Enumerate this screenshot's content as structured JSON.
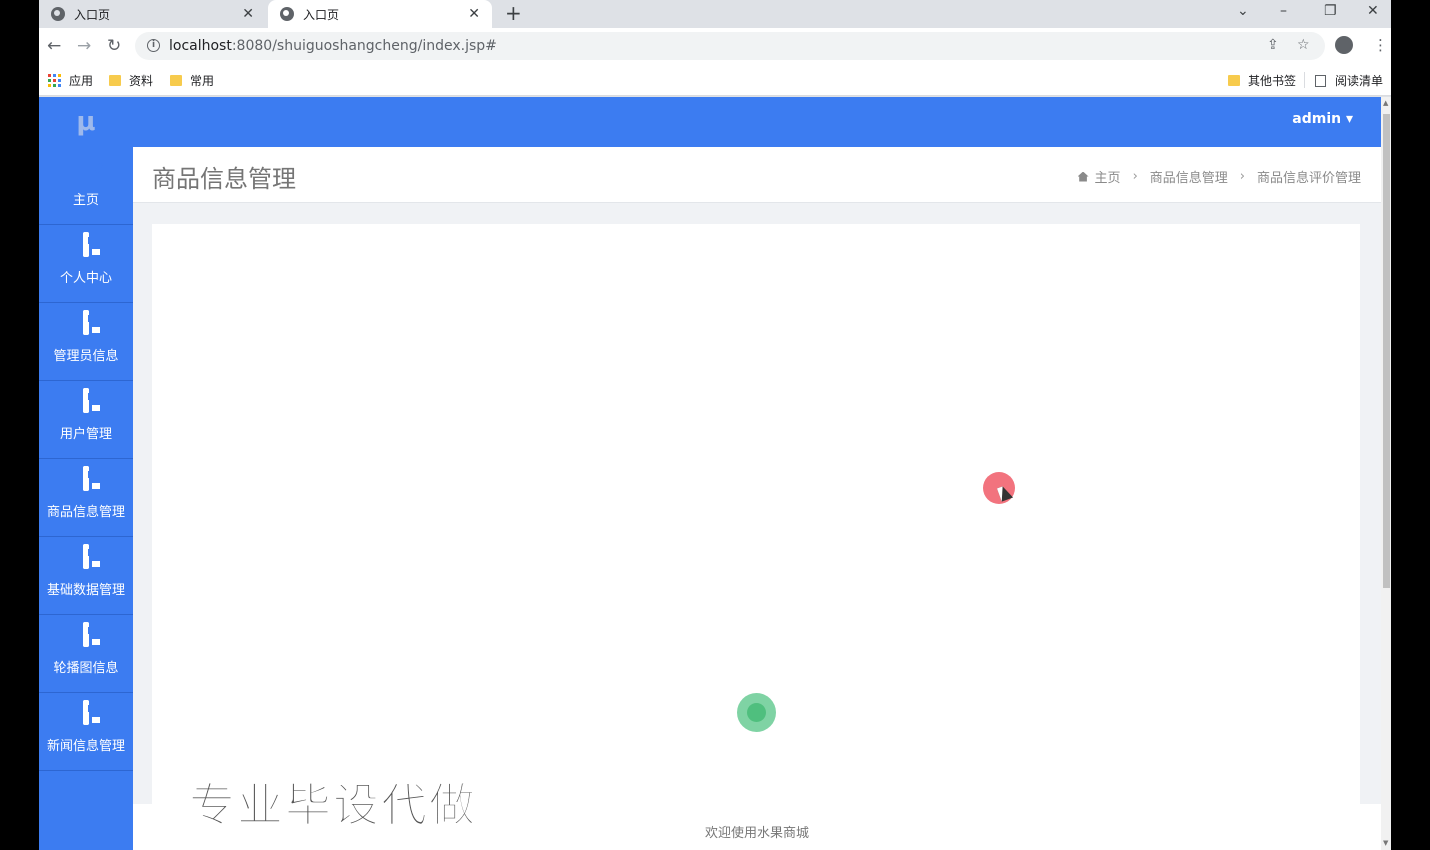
{
  "browser": {
    "tabs": [
      {
        "title": "入口页",
        "active": false
      },
      {
        "title": "入口页",
        "active": true
      }
    ],
    "new_tab": "+",
    "window_controls": {
      "dropdown": "⌄",
      "minimize": "–",
      "restore": "❐",
      "close": "✕"
    },
    "nav": {
      "back": "←",
      "forward": "→",
      "reload": "↻"
    },
    "url_host": "localhost",
    "url_path": ":8080/shuiguoshangcheng/index.jsp#",
    "bookmarks": [
      "应用",
      "资料",
      "常用"
    ],
    "bookmarks_right": [
      "其他书签",
      "阅读清单"
    ]
  },
  "app": {
    "logo": "μ",
    "user": "admin",
    "sidebar": [
      {
        "label": "主页",
        "icon": "dashboard-icon"
      },
      {
        "label": "个人中心",
        "icon": "monitor-icon"
      },
      {
        "label": "管理员信息",
        "icon": "monitor-icon"
      },
      {
        "label": "用户管理",
        "icon": "monitor-icon"
      },
      {
        "label": "商品信息管理",
        "icon": "monitor-icon"
      },
      {
        "label": "基础数据管理",
        "icon": "monitor-icon"
      },
      {
        "label": "轮播图信息",
        "icon": "monitor-icon"
      },
      {
        "label": "新闻信息管理",
        "icon": "monitor-icon"
      }
    ],
    "page_title": "商品信息管理",
    "breadcrumb": [
      "主页",
      "商品信息管理",
      "商品信息评价管理"
    ],
    "footer": "欢迎使用水果商城",
    "watermark": "专业毕设代做"
  },
  "colors": {
    "accent": "#3c7cf1",
    "page_bg": "#f0f2f5"
  }
}
